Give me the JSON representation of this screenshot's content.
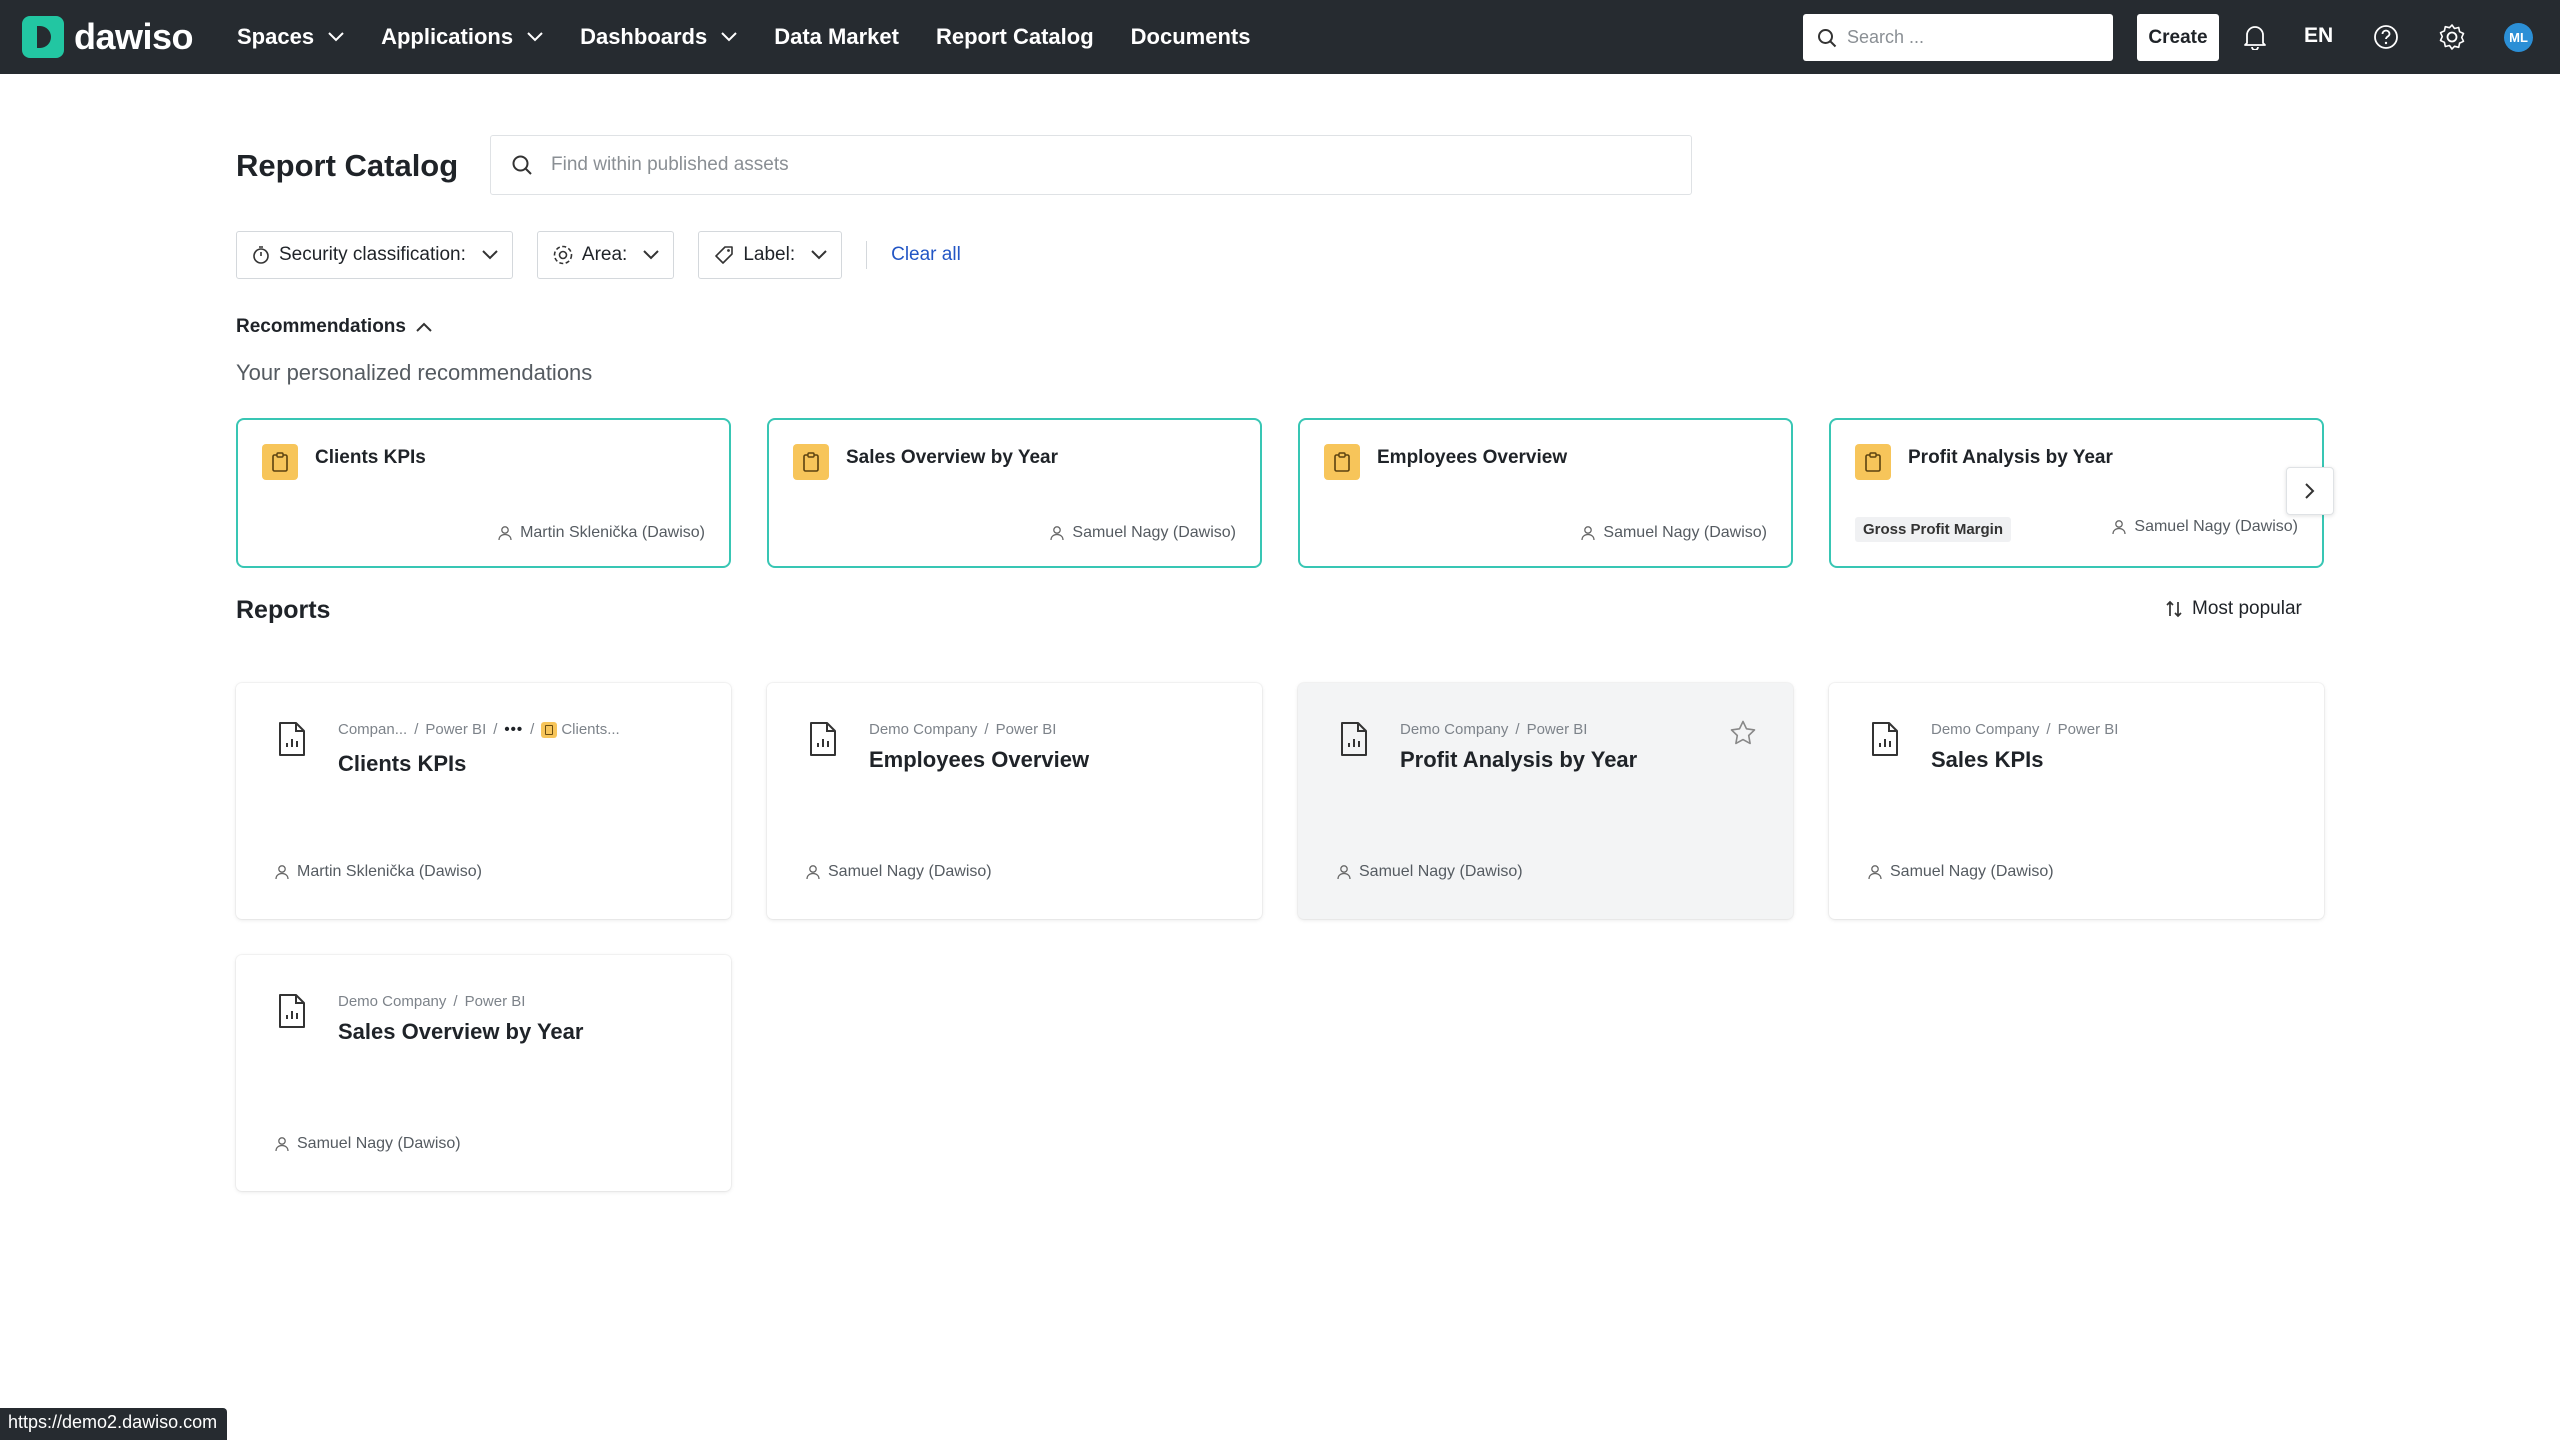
{
  "brand": {
    "name": "dawiso",
    "color": "#22c6a2"
  },
  "nav": {
    "items": [
      {
        "label": "Spaces",
        "dropdown": true
      },
      {
        "label": "Applications",
        "dropdown": true
      },
      {
        "label": "Dashboards",
        "dropdown": true
      },
      {
        "label": "Data Market",
        "dropdown": false
      },
      {
        "label": "Report Catalog",
        "dropdown": false
      },
      {
        "label": "Documents",
        "dropdown": false
      }
    ]
  },
  "topbar": {
    "search_placeholder": "Search ...",
    "create_label": "Create",
    "language": "EN",
    "avatar_initials": "ML"
  },
  "page": {
    "title": "Report Catalog",
    "search_placeholder": "Find within published assets"
  },
  "filters": {
    "security": "Security classification:",
    "area": "Area:",
    "label": "Label:",
    "clear_all": "Clear all"
  },
  "recommendations": {
    "toggle_label": "Recommendations",
    "subtitle": "Your personalized recommendations",
    "cards": [
      {
        "title": "Clients KPIs",
        "owner": "Martin Sklenička (Dawiso)",
        "tag": ""
      },
      {
        "title": "Sales Overview by Year",
        "owner": "Samuel Nagy (Dawiso)",
        "tag": ""
      },
      {
        "title": "Employees Overview",
        "owner": "Samuel Nagy (Dawiso)",
        "tag": ""
      },
      {
        "title": "Profit Analysis by Year",
        "owner": "Samuel Nagy (Dawiso)",
        "tag": "Gross Profit Margin"
      }
    ]
  },
  "reports": {
    "title": "Reports",
    "sort_label": "Most popular",
    "cards": [
      {
        "path": [
          "Compan...",
          "Power BI",
          "...",
          "Clients..."
        ],
        "title": "Clients KPIs",
        "owner": "Martin Sklenička (Dawiso)"
      },
      {
        "path": [
          "Demo Company",
          "Power BI"
        ],
        "title": "Employees Overview",
        "owner": "Samuel Nagy (Dawiso)"
      },
      {
        "path": [
          "Demo Company",
          "Power BI"
        ],
        "title": "Profit Analysis by Year",
        "owner": "Samuel Nagy (Dawiso)"
      },
      {
        "path": [
          "Demo Company",
          "Power BI"
        ],
        "title": "Sales KPIs",
        "owner": "Samuel Nagy (Dawiso)"
      },
      {
        "path": [
          "Demo Company",
          "Power BI"
        ],
        "title": "Sales Overview by Year",
        "owner": "Samuel Nagy (Dawiso)"
      }
    ]
  },
  "status_bar": {
    "url": "https://demo2.dawiso.com"
  }
}
